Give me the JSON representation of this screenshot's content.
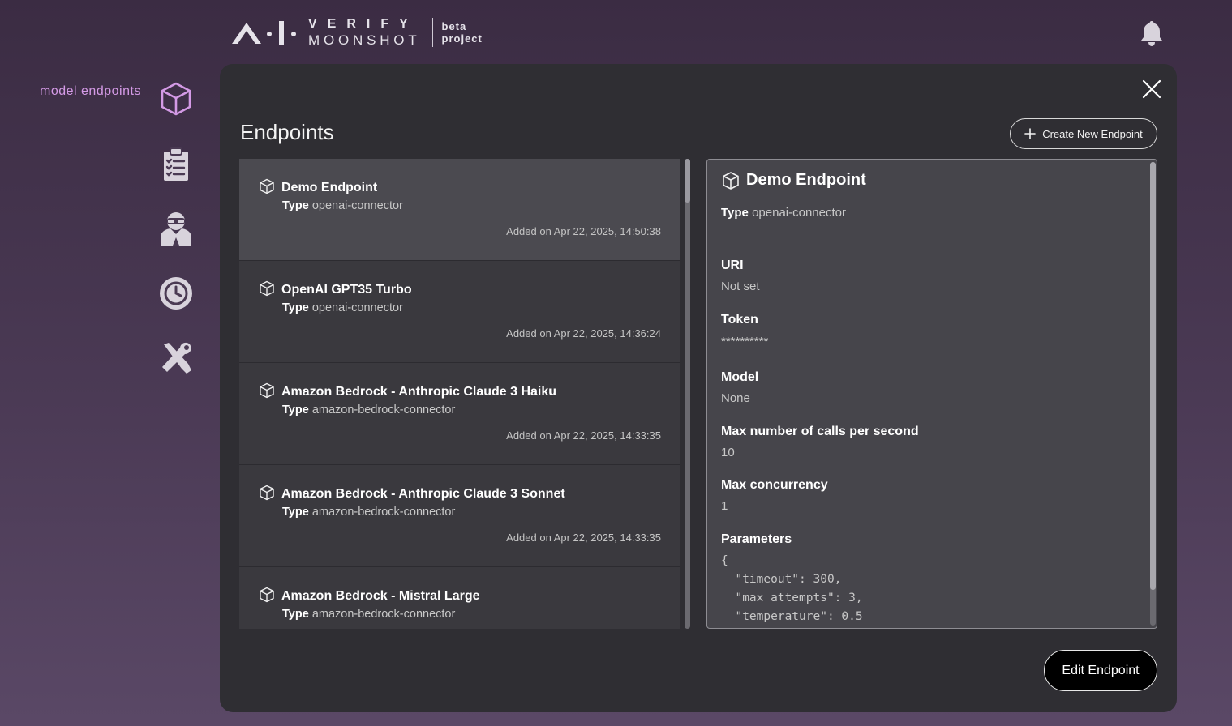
{
  "header": {
    "logo_verify": "VERIFY",
    "logo_moonshot": "MOONSHOT",
    "logo_beta_line1": "beta",
    "logo_beta_line2": "project"
  },
  "sidebar": {
    "active_label": "model endpoints",
    "items": [
      {
        "icon": "cube-icon"
      },
      {
        "icon": "clipboard-icon"
      },
      {
        "icon": "redteam-icon"
      },
      {
        "icon": "history-icon"
      },
      {
        "icon": "tools-icon"
      }
    ]
  },
  "main": {
    "title": "Endpoints",
    "create_label": "Create New Endpoint",
    "edit_label": "Edit Endpoint",
    "endpoints": [
      {
        "name": "Demo Endpoint",
        "type_label": "Type",
        "type": "openai-connector",
        "added": "Added on Apr 22, 2025, 14:50:38",
        "selected": true
      },
      {
        "name": "OpenAI GPT35 Turbo",
        "type_label": "Type",
        "type": "openai-connector",
        "added": "Added on Apr 22, 2025, 14:36:24"
      },
      {
        "name": "Amazon Bedrock - Anthropic Claude 3 Haiku",
        "type_label": "Type",
        "type": "amazon-bedrock-connector",
        "added": "Added on Apr 22, 2025, 14:33:35"
      },
      {
        "name": "Amazon Bedrock - Anthropic Claude 3 Sonnet",
        "type_label": "Type",
        "type": "amazon-bedrock-connector",
        "added": "Added on Apr 22, 2025, 14:33:35"
      },
      {
        "name": "Amazon Bedrock - Mistral Large",
        "type_label": "Type",
        "type": "amazon-bedrock-connector",
        "added": ""
      }
    ]
  },
  "detail": {
    "name": "Demo Endpoint",
    "type_label": "Type",
    "type": "openai-connector",
    "uri_label": "URI",
    "uri": "Not set",
    "token_label": "Token",
    "token": "**********",
    "model_label": "Model",
    "model": "None",
    "calls_label": "Max number of calls per second",
    "calls": "10",
    "concurrency_label": "Max concurrency",
    "concurrency": "1",
    "parameters_label": "Parameters",
    "parameters": "{\n  \"timeout\": 300,\n  \"max_attempts\": 3,\n  \"temperature\": 0.5"
  }
}
